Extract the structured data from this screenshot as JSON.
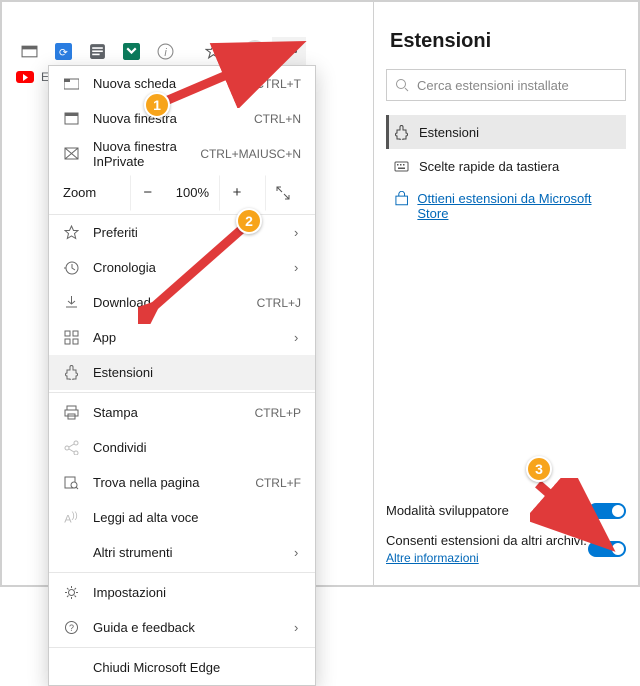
{
  "window": {
    "yt_label": "ET"
  },
  "toolbar": {},
  "menu": {
    "new_tab": "Nuova scheda",
    "new_tab_sc": "CTRL+T",
    "new_window": "Nuova finestra",
    "new_window_sc": "CTRL+N",
    "new_inprivate": "Nuova finestra InPrivate",
    "new_inprivate_sc": "CTRL+MAIUSC+N",
    "zoom_label": "Zoom",
    "zoom_value": "100%",
    "favorites": "Preferiti",
    "history": "Cronologia",
    "downloads": "Download",
    "downloads_sc": "CTRL+J",
    "apps": "App",
    "extensions": "Estensioni",
    "print": "Stampa",
    "print_sc": "CTRL+P",
    "share": "Condividi",
    "find": "Trova nella pagina",
    "find_sc": "CTRL+F",
    "read_aloud": "Leggi ad alta voce",
    "more_tools": "Altri strumenti",
    "settings": "Impostazioni",
    "help": "Guida e feedback",
    "close_edge": "Chiudi Microsoft Edge"
  },
  "side": {
    "title": "Estensioni",
    "search_placeholder": "Cerca estensioni installate",
    "nav_extensions": "Estensioni",
    "nav_shortcuts": "Scelte rapide da tastiera",
    "store_link": "Ottieni estensioni da Microsoft Store",
    "dev_mode": "Modalità sviluppatore",
    "allow_other": "Consenti estensioni da altri archivi.",
    "more_info": "Altre informazioni"
  },
  "callouts": {
    "c1": "1",
    "c2": "2",
    "c3": "3"
  }
}
